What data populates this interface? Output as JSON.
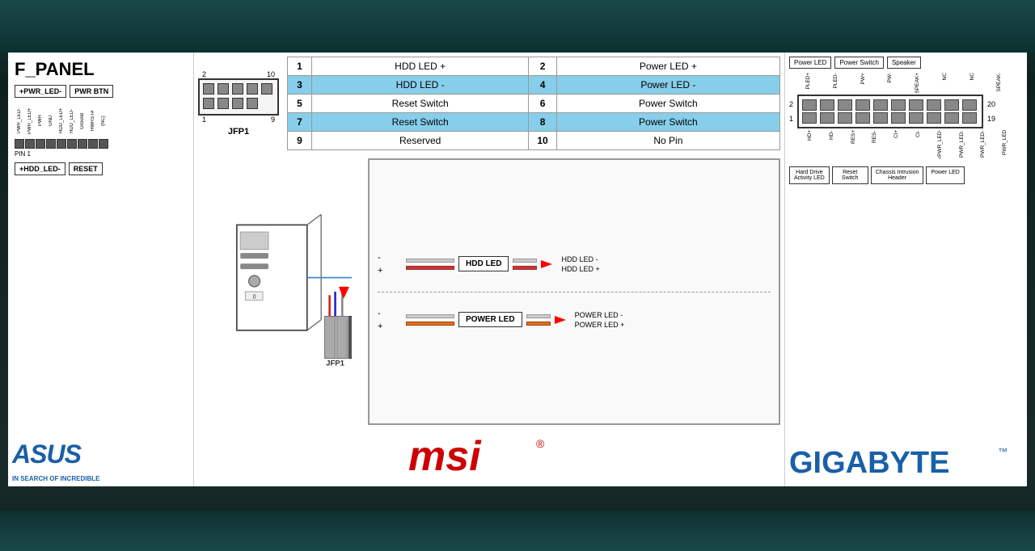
{
  "topBar": {
    "label": "top-bar"
  },
  "bottomBar": {
    "label": "bottom-bar"
  },
  "left": {
    "title": "F_PANEL",
    "pins": {
      "row1": [
        "+PWR_LED-",
        "PWR BTN"
      ],
      "verticalLabels": [
        "PWR_LED-",
        "PWR_LED+",
        "PWR",
        "GND",
        "HDD_LED+",
        "HDD_LED-",
        "Ground",
        "HWRST#",
        "(NC)",
        "PIN 1"
      ],
      "row2": [
        "+HDD_LED-",
        "RESET"
      ]
    },
    "logo": "ASUS",
    "tagline": "IN SEARCH OF INCREDIBLE"
  },
  "middle": {
    "connectorLabel": "JFP1",
    "connectorNumbers": {
      "topLeft": "2",
      "topRight": "10",
      "bottomLeft": "1",
      "bottomRight": "9"
    },
    "table": {
      "rows": [
        {
          "pin1": "1",
          "label1": "HDD LED +",
          "pin2": "2",
          "label2": "Power LED +",
          "highlighted": false
        },
        {
          "pin1": "3",
          "label1": "HDD LED -",
          "pin2": "4",
          "label2": "Power LED -",
          "highlighted": true
        },
        {
          "pin1": "5",
          "label1": "Reset Switch",
          "pin2": "6",
          "label2": "Power Switch",
          "highlighted": false
        },
        {
          "pin1": "7",
          "label1": "Reset Switch",
          "pin2": "8",
          "label2": "Power Switch",
          "highlighted": true
        },
        {
          "pin1": "9",
          "label1": "Reserved",
          "pin2": "10",
          "label2": "No Pin",
          "highlighted": false
        }
      ]
    },
    "ledDiagram": {
      "hddRow": {
        "neg": "-",
        "pos": "+",
        "label": "HDD LED",
        "output1": "HDD LED -",
        "output2": "HDD LED +"
      },
      "powerRow": {
        "neg": "-",
        "pos": "+",
        "label": "POWER LED",
        "output1": "POWER LED -",
        "output2": "POWER LED +"
      }
    },
    "logo": "msi"
  },
  "right": {
    "headers": [
      "Power LED",
      "Power Switch",
      "Speaker"
    ],
    "verticalLabels": [
      "PLED+",
      "PLED-",
      "PW+",
      "PW-",
      "SPEAK+",
      "NC",
      "NC",
      "SPEAK-"
    ],
    "rowNumbers": {
      "left2": "2",
      "right20": "20",
      "left1": "1",
      "right19": "19"
    },
    "footerLabels": [
      {
        "text": "Hard Drive\nActivity LED"
      },
      {
        "text": "Reset\nSwitch"
      },
      {
        "text": "Chassis Intrusion\nHeader"
      },
      {
        "text": "Power LED"
      }
    ],
    "bottomLabels": [
      "HD+",
      "HD-",
      "RES+",
      "RES-",
      "CI+",
      "CI-",
      "rPWR_LED+",
      "PWR_LED-",
      "PWR_LED-"
    ],
    "logo": "GIGABYTE",
    "tm": "™"
  }
}
